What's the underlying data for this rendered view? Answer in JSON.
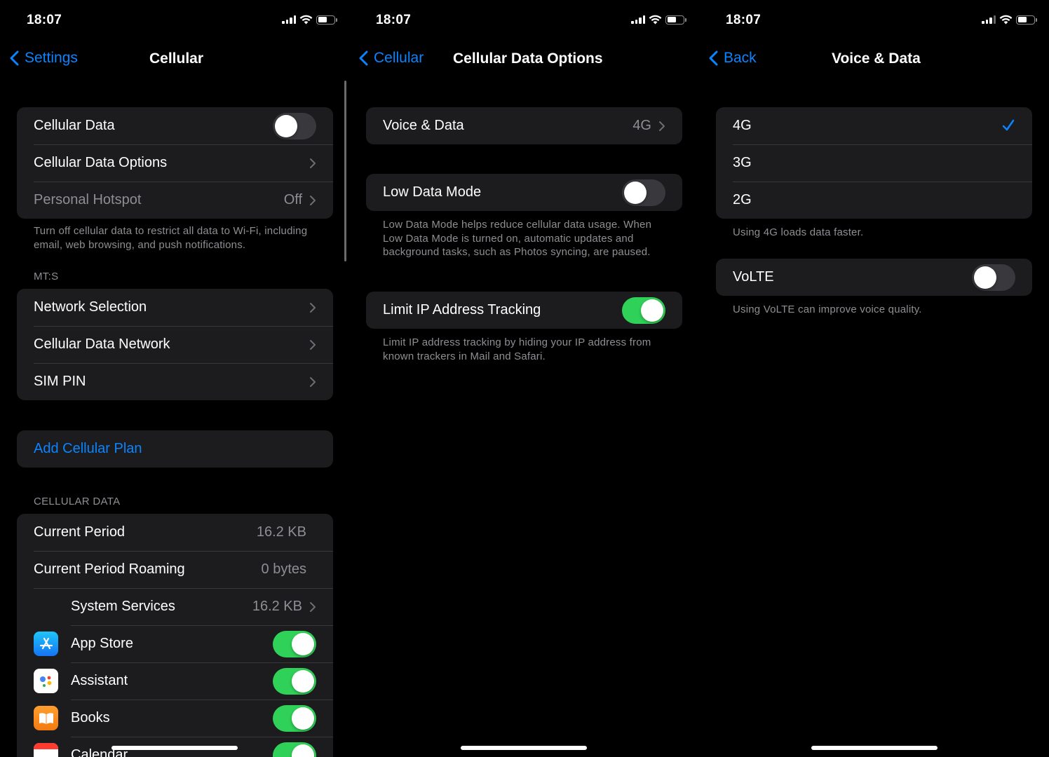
{
  "status": {
    "time": "18:07"
  },
  "screen1": {
    "nav": {
      "back_label": "Settings",
      "title": "Cellular"
    },
    "group1": [
      {
        "label": "Cellular Data",
        "toggle": false
      },
      {
        "label": "Cellular Data Options"
      },
      {
        "label": "Personal Hotspot",
        "value": "Off"
      }
    ],
    "group1_footer": "Turn off cellular data to restrict all data to Wi-Fi, including email, web browsing, and push notifications.",
    "carrier_header": "MT:S",
    "group2": [
      {
        "label": "Network Selection"
      },
      {
        "label": "Cellular Data Network"
      },
      {
        "label": "SIM PIN"
      }
    ],
    "add_plan": "Add Cellular Plan",
    "data_header": "CELLULAR DATA",
    "usage": [
      {
        "label": "Current Period",
        "value": "16.2 KB"
      },
      {
        "label": "Current Period Roaming",
        "value": "0 bytes"
      },
      {
        "label": "System Services",
        "value": "16.2 KB"
      }
    ],
    "apps": [
      {
        "name": "App Store",
        "icon": "app-store-icon",
        "toggle": true
      },
      {
        "name": "Assistant",
        "icon": "assistant-icon",
        "toggle": true
      },
      {
        "name": "Books",
        "icon": "books-icon",
        "toggle": true
      },
      {
        "name": "Calendar",
        "icon": "calendar-icon",
        "toggle": true
      }
    ]
  },
  "screen2": {
    "nav": {
      "back_label": "Cellular",
      "title": "Cellular Data Options"
    },
    "voice_data": {
      "label": "Voice & Data",
      "value": "4G"
    },
    "low_data": {
      "label": "Low Data Mode",
      "toggle": false
    },
    "low_data_footer": "Low Data Mode helps reduce cellular data usage. When Low Data Mode is turned on, automatic updates and background tasks, such as Photos syncing, are paused.",
    "limit_ip": {
      "label": "Limit IP Address Tracking",
      "toggle": true
    },
    "limit_ip_footer": "Limit IP address tracking by hiding your IP address from known trackers in Mail and Safari."
  },
  "screen3": {
    "nav": {
      "back_label": "Back",
      "title": "Voice & Data"
    },
    "options": [
      {
        "label": "4G",
        "selected": true
      },
      {
        "label": "3G",
        "selected": false
      },
      {
        "label": "2G",
        "selected": false
      }
    ],
    "options_footer": "Using 4G loads data faster.",
    "volte": {
      "label": "VoLTE",
      "toggle": false
    },
    "volte_footer": "Using VoLTE can improve voice quality."
  },
  "colors": {
    "accent": "#0a84ff",
    "toggle_on": "#30d158",
    "cell_bg": "#1c1c1e",
    "secondary_text": "#8e8e93"
  }
}
